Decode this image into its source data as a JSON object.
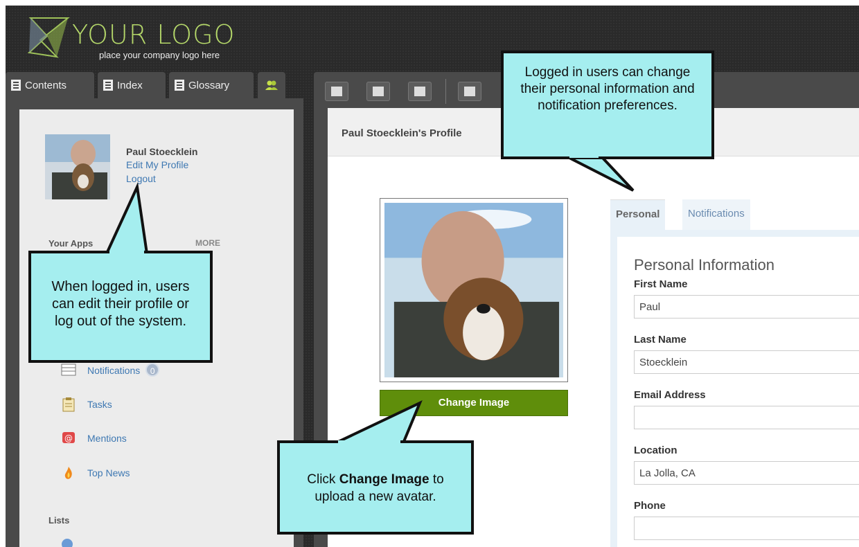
{
  "logo": {
    "title": "YOUR LOGO",
    "subtitle": "place your company logo here"
  },
  "left_tabs": [
    {
      "label": "Contents",
      "icon": "contents-icon"
    },
    {
      "label": "Index",
      "icon": "index-icon"
    },
    {
      "label": "Glossary",
      "icon": "glossary-icon"
    },
    {
      "label": "",
      "icon": "users-icon"
    }
  ],
  "profile": {
    "name": "Paul Stoecklein",
    "edit_link": "Edit My Profile",
    "logout_link": "Logout"
  },
  "sidebar": {
    "apps_heading": "Your Apps",
    "more_label": "MORE",
    "items": [
      {
        "label": "Notifications",
        "icon": "notifications-icon",
        "badge": "0"
      },
      {
        "label": "Tasks",
        "icon": "clipboard-icon"
      },
      {
        "label": "Mentions",
        "icon": "at-mention-icon"
      },
      {
        "label": "Top News",
        "icon": "flame-icon"
      }
    ],
    "lists_heading": "Lists"
  },
  "toolbar": {
    "buttons": [
      "print-icon",
      "list-icon",
      "clear-highlight-icon",
      "user-icon"
    ]
  },
  "main": {
    "page_title": "Paul Stoecklein's Profile",
    "change_image_label": "Change Image",
    "tabs": [
      {
        "label": "Personal",
        "active": true
      },
      {
        "label": "Notifications",
        "active": false
      }
    ],
    "form_heading": "Personal Information",
    "fields": [
      {
        "label": "First Name",
        "value": "Paul"
      },
      {
        "label": "Last Name",
        "value": "Stoecklein"
      },
      {
        "label": "Email Address",
        "value": ""
      },
      {
        "label": "Location",
        "value": "La Jolla, CA"
      },
      {
        "label": "Phone",
        "value": ""
      }
    ]
  },
  "callouts": {
    "top": "Logged in users can change their personal information and notification preferences.",
    "left": "When logged in, users can edit their profile or log out of the system.",
    "bottom_pre": "Click ",
    "bottom_bold": "Change Image",
    "bottom_post": " to upload a new avatar."
  },
  "colors": {
    "accent_green": "#5f8e0b",
    "logo_green": "#b5d86a",
    "link_blue": "#3e78b2",
    "callout_fill": "#a5eeef"
  }
}
